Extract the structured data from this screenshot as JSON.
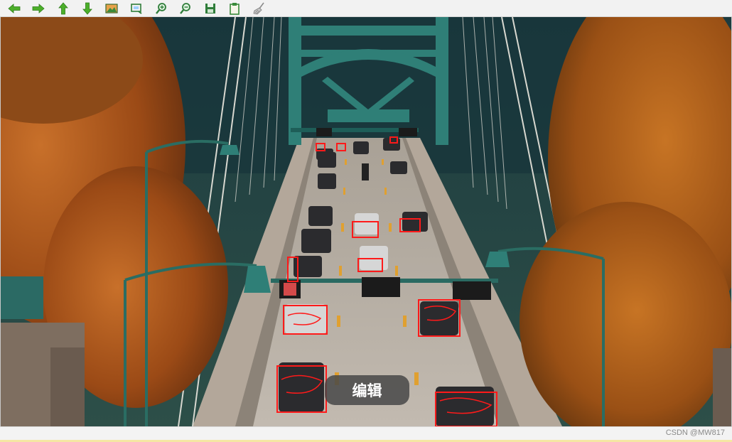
{
  "toolbar": {
    "buttons": [
      {
        "name": "back-arrow-icon",
        "color": "#4caf2a"
      },
      {
        "name": "forward-arrow-icon",
        "color": "#4caf2a"
      },
      {
        "name": "up-arrow-icon",
        "color": "#4caf2a"
      },
      {
        "name": "down-arrow-icon",
        "color": "#4caf2a"
      },
      {
        "name": "image-icon",
        "color": "#3a7a2e"
      },
      {
        "name": "fit-window-icon",
        "color": "#2f7d3a"
      },
      {
        "name": "zoom-in-icon",
        "color": "#2f7d3a"
      },
      {
        "name": "zoom-out-icon",
        "color": "#2f7d3a"
      },
      {
        "name": "save-icon",
        "color": "#2f7d3a"
      },
      {
        "name": "clipboard-icon",
        "color": "#3a8a3a"
      },
      {
        "name": "broom-icon",
        "color": "#888888"
      }
    ]
  },
  "overlay": {
    "edit_label": "编辑",
    "box_color": "#ff1a1a"
  },
  "statusbar": {
    "watermark": "CSDN @MW817"
  },
  "colors": {
    "bridge_teal": "#2f7f77",
    "foliage_orange": "#b45a1a",
    "road": "#b9b1a6"
  }
}
